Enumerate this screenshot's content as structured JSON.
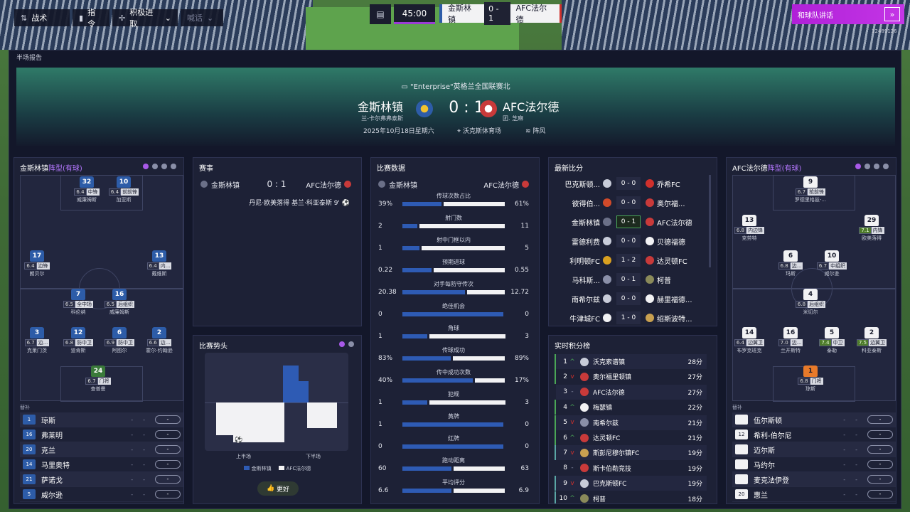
{
  "topbar": {
    "tactics_label": "战术",
    "instructions_label": "指令",
    "mentality_label": "积极进取",
    "shout_label": "喊话",
    "match_time": "45:00",
    "home_short": "金斯林镇",
    "score": "0 - 1",
    "away_short": "AFC法尔德",
    "team_talk_label": "和球队讲话",
    "version": "12489126"
  },
  "panel_title": "半场报告",
  "hero": {
    "competition": "\"Enterprise\"英格兰全国联赛北",
    "home_name": "金斯林镇",
    "home_manager": "兰-卡尔弗弗泰斯",
    "score": "0 : 1",
    "away_name": "AFC法尔德",
    "away_manager": "团. 芝麻",
    "date": "2025年10月18日星期六",
    "stadium": "沃克斯体育场",
    "weather": "阵风"
  },
  "home_lineup": {
    "title": "金斯林镇",
    "title_suffix": "阵型(有球)",
    "players": [
      {
        "num": "32",
        "rating": "6.4",
        "pos": "中锋",
        "name": "威廉姆斯"
      },
      {
        "num": "10",
        "rating": "6.4",
        "pos": "前前锋",
        "name": "加亚斯"
      },
      {
        "num": "17",
        "rating": "6.4",
        "pos": "边锋",
        "name": "朗贝尔"
      },
      {
        "num": "13",
        "rating": "6.4",
        "pos": "内...",
        "name": "戴维斯"
      },
      {
        "num": "7",
        "rating": "6.5",
        "pos": "全中场",
        "name": "科伦纳"
      },
      {
        "num": "16",
        "rating": "6.5",
        "pos": "后组织",
        "name": "威廉姆斯"
      },
      {
        "num": "3",
        "rating": "6.7",
        "pos": "边...",
        "name": "克莱门茨"
      },
      {
        "num": "12",
        "rating": "6.8",
        "pos": "防中卫",
        "name": "道肯斯"
      },
      {
        "num": "6",
        "rating": "6.9",
        "pos": "防中卫",
        "name": "阿图尔"
      },
      {
        "num": "2",
        "rating": "6.6",
        "pos": "边...",
        "name": "霍尔-约翰逊"
      },
      {
        "num": "24",
        "rating": "6.7",
        "pos": "门将",
        "name": "查普曼"
      }
    ],
    "subs_label": "替补",
    "subs": [
      {
        "num": "1",
        "name": "琼斯"
      },
      {
        "num": "16",
        "name": "弗莱明"
      },
      {
        "num": "20",
        "name": "克兰"
      },
      {
        "num": "14",
        "name": "马里奥特"
      },
      {
        "num": "21",
        "name": "萨诺戈"
      },
      {
        "num": "5",
        "name": "威尔逊"
      }
    ],
    "sub_dash": "-",
    "sub_btn": "-"
  },
  "events": {
    "title": "赛事",
    "home": "金斯林镇",
    "score": "0 : 1",
    "away": "AFC法尔德",
    "goal_text": "丹尼·欧美落得 基兰·科亚泰斯 9'"
  },
  "momentum": {
    "title": "比赛势头",
    "first_half": "上半场",
    "second_half": "下半场",
    "legend_home": "金斯林镇",
    "legend_away": "AFC法尔德",
    "good_label": "更好"
  },
  "stats": {
    "title": "比赛数据",
    "home": "金斯林镇",
    "away": "AFC法尔德",
    "rows": [
      {
        "label": "传球次数占比",
        "h": "39%",
        "a": "61%",
        "hp": 39
      },
      {
        "label": "射门数",
        "h": "2",
        "a": "11",
        "hp": 15
      },
      {
        "label": "射中门框以内",
        "h": "1",
        "a": "5",
        "hp": 17
      },
      {
        "label": "预期进球",
        "h": "0.22",
        "a": "0.55",
        "hp": 29
      },
      {
        "label": "对手每防守传次",
        "h": "20.38",
        "a": "12.72",
        "hp": 62
      },
      {
        "label": "绝佳机会",
        "h": "0",
        "a": "0",
        "hp": 0
      },
      {
        "label": "角球",
        "h": "1",
        "a": "3",
        "hp": 25
      },
      {
        "label": "传球成功",
        "h": "83%",
        "a": "89%",
        "hp": 48
      },
      {
        "label": "传中成功次数",
        "h": "40%",
        "a": "17%",
        "hp": 70
      },
      {
        "label": "犯规",
        "h": "1",
        "a": "3",
        "hp": 25
      },
      {
        "label": "黄牌",
        "h": "1",
        "a": "0",
        "hp": 100
      },
      {
        "label": "红牌",
        "h": "0",
        "a": "0",
        "hp": 0
      },
      {
        "label": "跑动距离",
        "h": "60",
        "a": "63",
        "hp": 49
      },
      {
        "label": "平均评分",
        "h": "6.6",
        "a": "6.9",
        "hp": 49
      }
    ]
  },
  "latest": {
    "title": "最新比分",
    "rows": [
      {
        "h": "巴克斯顿...",
        "s": "0 - 0",
        "a": "乔希FC",
        "live": false
      },
      {
        "h": "彼得伯...",
        "s": "0 - 0",
        "a": "奥尔福...",
        "live": false
      },
      {
        "h": "金斯林镇",
        "s": "0 - 1",
        "a": "AFC法尔德",
        "live": true
      },
      {
        "h": "雷德利费",
        "s": "0 - 0",
        "a": "贝德福德",
        "live": false
      },
      {
        "h": "利明顿FC",
        "s": "1 - 2",
        "a": "达灵顿FC",
        "live": false
      },
      {
        "h": "马科斯...",
        "s": "0 - 1",
        "a": "柯普",
        "live": false
      },
      {
        "h": "南希尔兹",
        "s": "0 - 0",
        "a": "赫里福德...",
        "live": false
      },
      {
        "h": "牛津城FC",
        "s": "1 - 0",
        "a": "绍斯波特...",
        "live": false
      }
    ]
  },
  "table": {
    "title": "实时积分榜",
    "rows": [
      {
        "p": "1",
        "mv": "^",
        "t": "沃克索谱镇",
        "pts": "28分"
      },
      {
        "p": "2",
        "mv": "v",
        "t": "奥尔福里顿镇",
        "pts": "27分"
      },
      {
        "p": "3",
        "mv": "-",
        "t": "AFC法尔德",
        "pts": "27分"
      },
      {
        "p": "4",
        "mv": "^",
        "t": "梅瑟镇",
        "pts": "22分"
      },
      {
        "p": "5",
        "mv": "v",
        "t": "南希尔兹",
        "pts": "21分"
      },
      {
        "p": "6",
        "mv": "^",
        "t": "达灵顿FC",
        "pts": "21分"
      },
      {
        "p": "7",
        "mv": "v",
        "t": "斯彭尼穆尔镇FC",
        "pts": "19分"
      },
      {
        "p": "8",
        "mv": "-",
        "t": "斯卡伯勒竞技",
        "pts": "19分"
      },
      {
        "p": "9",
        "mv": "v",
        "t": "巴克斯顿FC",
        "pts": "19分"
      },
      {
        "p": "10",
        "mv": "^",
        "t": "柯普",
        "pts": "18分"
      }
    ]
  },
  "away_lineup": {
    "title": "AFC法尔德",
    "title_suffix": "阵型(有球)",
    "players": [
      {
        "num": "9",
        "rating": "6.7",
        "pos": "抢前锋",
        "name": "罗德里格兹-..."
      },
      {
        "num": "13",
        "rating": "6.8",
        "pos": "内边锋",
        "name": "克劳特"
      },
      {
        "num": "29",
        "rating": "7.1",
        "pos": "内锋",
        "name": "欧美落得",
        "good": true
      },
      {
        "num": "6",
        "rating": "6.8",
        "pos": "边...",
        "name": "玛斯"
      },
      {
        "num": "10",
        "rating": "6.7",
        "pos": "中组织",
        "name": "威尔逊"
      },
      {
        "num": "4",
        "rating": "6.8",
        "pos": "后组织",
        "name": "米切尔"
      },
      {
        "num": "14",
        "rating": "6.4",
        "pos": "边翼卫",
        "name": "布罗克班克"
      },
      {
        "num": "16",
        "rating": "7.0",
        "pos": "边...",
        "name": "兰开斯特"
      },
      {
        "num": "5",
        "rating": "7.4",
        "pos": "中卫",
        "name": "泰勒",
        "good": true
      },
      {
        "num": "2",
        "rating": "7.5",
        "pos": "边翼卫",
        "name": "科亚泰斯",
        "good": true
      },
      {
        "num": "1",
        "rating": "6.8",
        "pos": "门将",
        "name": "琼斯"
      }
    ],
    "subs_label": "替补",
    "subs": [
      {
        "num": "",
        "name": "伍尔斯顿"
      },
      {
        "num": "12",
        "name": "希利-伯尔尼"
      },
      {
        "num": "",
        "name": "迈尔斯"
      },
      {
        "num": "",
        "name": "马约尔"
      },
      {
        "num": "",
        "name": "麦克法伊登"
      },
      {
        "num": "20",
        "name": "惠兰"
      }
    ],
    "sub_dash": "-",
    "sub_btn": "-"
  },
  "colors": {
    "accent": "#a859e8",
    "home": "#2e5bb4",
    "away": "#f2f2f4",
    "good": "#4aa656"
  }
}
